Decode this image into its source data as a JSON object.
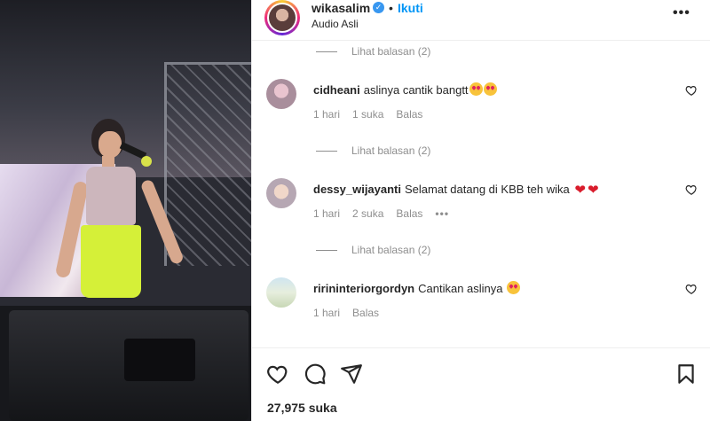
{
  "post": {
    "username": "wikasalim",
    "separator": "•",
    "follow_label": "Ikuti",
    "audio": "Audio Asli",
    "more_icon": "more-horizontal-icon"
  },
  "comments": [
    {
      "replies_label": "Lihat balasan (2)"
    },
    {
      "username": "cidheani",
      "text": "aslinya cantik bangtt",
      "time": "1 hari",
      "likes": "1 suka",
      "reply_label": "Balas",
      "replies_label": "Lihat balasan (2)"
    },
    {
      "username": "dessy_wijayanti",
      "text": "Selamat datang di KBB teh wika",
      "time": "1 hari",
      "likes": "2 suka",
      "reply_label": "Balas",
      "options": "•••",
      "replies_label": "Lihat balasan (2)"
    },
    {
      "username": "ririninteriorgordyn",
      "text": "Cantikan aslinya",
      "time": "1 hari",
      "reply_label": "Balas"
    }
  ],
  "footer": {
    "likes_count": "27,975 suka",
    "icons": [
      "heart-icon",
      "comment-icon",
      "share-icon",
      "save-icon"
    ]
  },
  "colors": {
    "link": "#0095f6",
    "muted": "#8e8e8e",
    "text": "#262626",
    "verified": "#3897f0"
  }
}
